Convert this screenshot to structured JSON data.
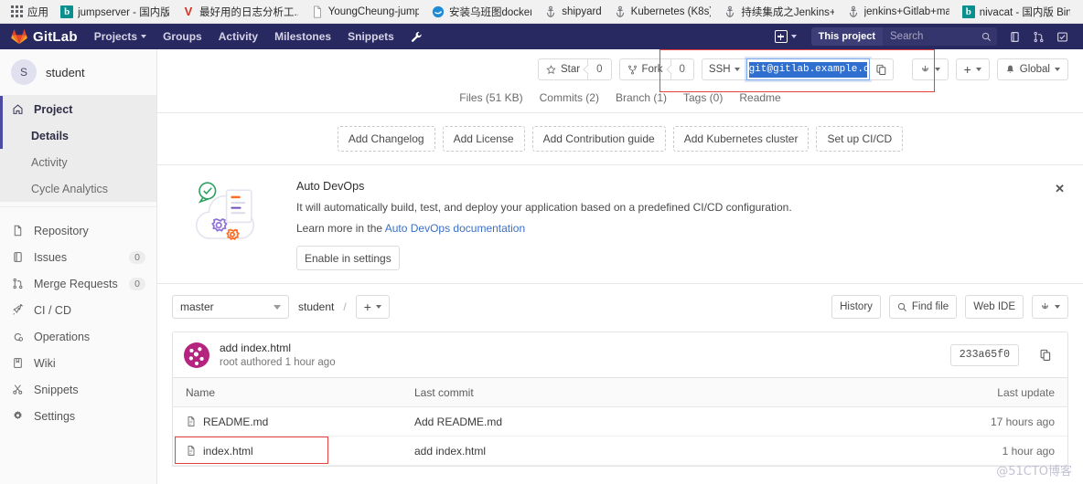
{
  "browser": {
    "apps_label": "应用",
    "bookmarks": [
      {
        "label": "jumpserver - 国内版",
        "icon": "bing-icon",
        "icon_kind": "square",
        "color": "#0a8f8f",
        "glyph": "b"
      },
      {
        "label": "最好用的日志分析工..",
        "icon": "v-icon",
        "icon_kind": "letter",
        "color": "#d93025",
        "glyph": "V"
      },
      {
        "label": "YoungCheung-jump",
        "icon": "page-icon",
        "icon_kind": "page",
        "color": "#8a8a8a",
        "glyph": ""
      },
      {
        "label": "安装乌班图docker",
        "icon": "circle-icon",
        "icon_kind": "circle",
        "color": "#1f8ad6",
        "glyph": ""
      },
      {
        "label": "shipyard",
        "icon": "anchor-icon",
        "icon_kind": "anchor",
        "color": "#5f6368",
        "glyph": ""
      },
      {
        "label": "Kubernetes (K8s)",
        "icon": "anchor-icon",
        "icon_kind": "anchor",
        "color": "#5f6368",
        "glyph": ""
      },
      {
        "label": "持续集成之Jenkins+",
        "icon": "anchor-icon",
        "icon_kind": "anchor",
        "color": "#5f6368",
        "glyph": ""
      },
      {
        "label": "jenkins+Gitlab+ma",
        "icon": "anchor-icon",
        "icon_kind": "anchor",
        "color": "#5f6368",
        "glyph": ""
      },
      {
        "label": "nivacat - 国内版 Bin",
        "icon": "bing-icon",
        "icon_kind": "square",
        "color": "#0a8f8f",
        "glyph": "b"
      }
    ]
  },
  "topnav": {
    "brand": "GitLab",
    "items": [
      {
        "label": "Projects",
        "has_caret": true
      },
      {
        "label": "Groups",
        "has_caret": false
      },
      {
        "label": "Activity",
        "has_caret": false
      },
      {
        "label": "Milestones",
        "has_caret": false
      },
      {
        "label": "Snippets",
        "has_caret": false
      }
    ],
    "wrench_icon": "wrench-icon",
    "plus_icon": "plus-icon",
    "search_scope": "This project",
    "search_placeholder": "Search",
    "right_icons": [
      "issues-icon",
      "merge-requests-icon",
      "todos-icon"
    ],
    "bg_color": "#292961"
  },
  "sidebar": {
    "user": {
      "initial": "S",
      "name": "student"
    },
    "items": [
      {
        "label": "Project",
        "icon": "home-icon",
        "active": true,
        "badge": null
      },
      {
        "label": "Details",
        "icon": null,
        "sub": true,
        "active": true,
        "badge": null
      },
      {
        "label": "Activity",
        "icon": null,
        "sub": true,
        "active": false,
        "badge": null
      },
      {
        "label": "Cycle Analytics",
        "icon": null,
        "sub": true,
        "active": false,
        "badge": null
      },
      {
        "label": "Repository",
        "icon": "file-icon",
        "active": false,
        "badge": null
      },
      {
        "label": "Issues",
        "icon": "issues-icon",
        "active": false,
        "badge": "0"
      },
      {
        "label": "Merge Requests",
        "icon": "merge-requests-icon",
        "active": false,
        "badge": "0"
      },
      {
        "label": "CI / CD",
        "icon": "rocket-icon",
        "active": false,
        "badge": null
      },
      {
        "label": "Operations",
        "icon": "operations-icon",
        "active": false,
        "badge": null
      },
      {
        "label": "Wiki",
        "icon": "book-icon",
        "active": false,
        "badge": null
      },
      {
        "label": "Snippets",
        "icon": "scissors-icon",
        "active": false,
        "badge": null
      },
      {
        "label": "Settings",
        "icon": "gear-icon",
        "active": false,
        "badge": null
      }
    ]
  },
  "project": {
    "star_label": "Star",
    "star_count": "0",
    "fork_label": "Fork",
    "fork_count": "0",
    "clone_protocol": "SSH",
    "clone_url": "git@gitlab.example.com:mdj/stud",
    "copy_icon": "copy-icon",
    "branch_icon_button": "branch-dropdown",
    "plus_button": "plus-dropdown",
    "notification_label": "Global",
    "notification_icon": "bell-icon",
    "tabs": [
      {
        "label": "Files (51 KB)"
      },
      {
        "label": "Commits (2)"
      },
      {
        "label": "Branch (1)"
      },
      {
        "label": "Tags (0)"
      },
      {
        "label": "Readme"
      }
    ],
    "quick_actions": [
      {
        "label": "Add Changelog"
      },
      {
        "label": "Add License"
      },
      {
        "label": "Add Contribution guide"
      },
      {
        "label": "Add Kubernetes cluster"
      },
      {
        "label": "Set up CI/CD"
      }
    ]
  },
  "devops": {
    "title": "Auto DevOps",
    "description": "It will automatically build, test, and deploy your application based on a predefined CI/CD configuration.",
    "learn_prefix": "Learn more in the ",
    "learn_link": "Auto DevOps documentation",
    "enable_button": "Enable in settings",
    "close_icon": "close-icon"
  },
  "repo": {
    "branch": "master",
    "breadcrumb_root": "student",
    "breadcrumb_sep": "/",
    "add_button": "+",
    "history_label": "History",
    "find_file_label": "Find file",
    "find_file_icon": "search-icon",
    "web_ide_label": "Web IDE",
    "download_icon": "download-icon"
  },
  "commit": {
    "message": "add index.html",
    "author_line": "root authored 1 hour ago",
    "sha": "233a65f0",
    "copy_icon": "copy-icon"
  },
  "files_table": {
    "columns": [
      "Name",
      "Last commit",
      "Last update"
    ],
    "rows": [
      {
        "name": "README.md",
        "icon": "file-icon",
        "last_commit": "Add README.md",
        "last_update": "17 hours ago",
        "highlighted": false
      },
      {
        "name": "index.html",
        "icon": "file-icon",
        "last_commit": "add index.html",
        "last_update": "1 hour ago",
        "highlighted": true
      }
    ]
  },
  "watermark": "@51CTO博客"
}
